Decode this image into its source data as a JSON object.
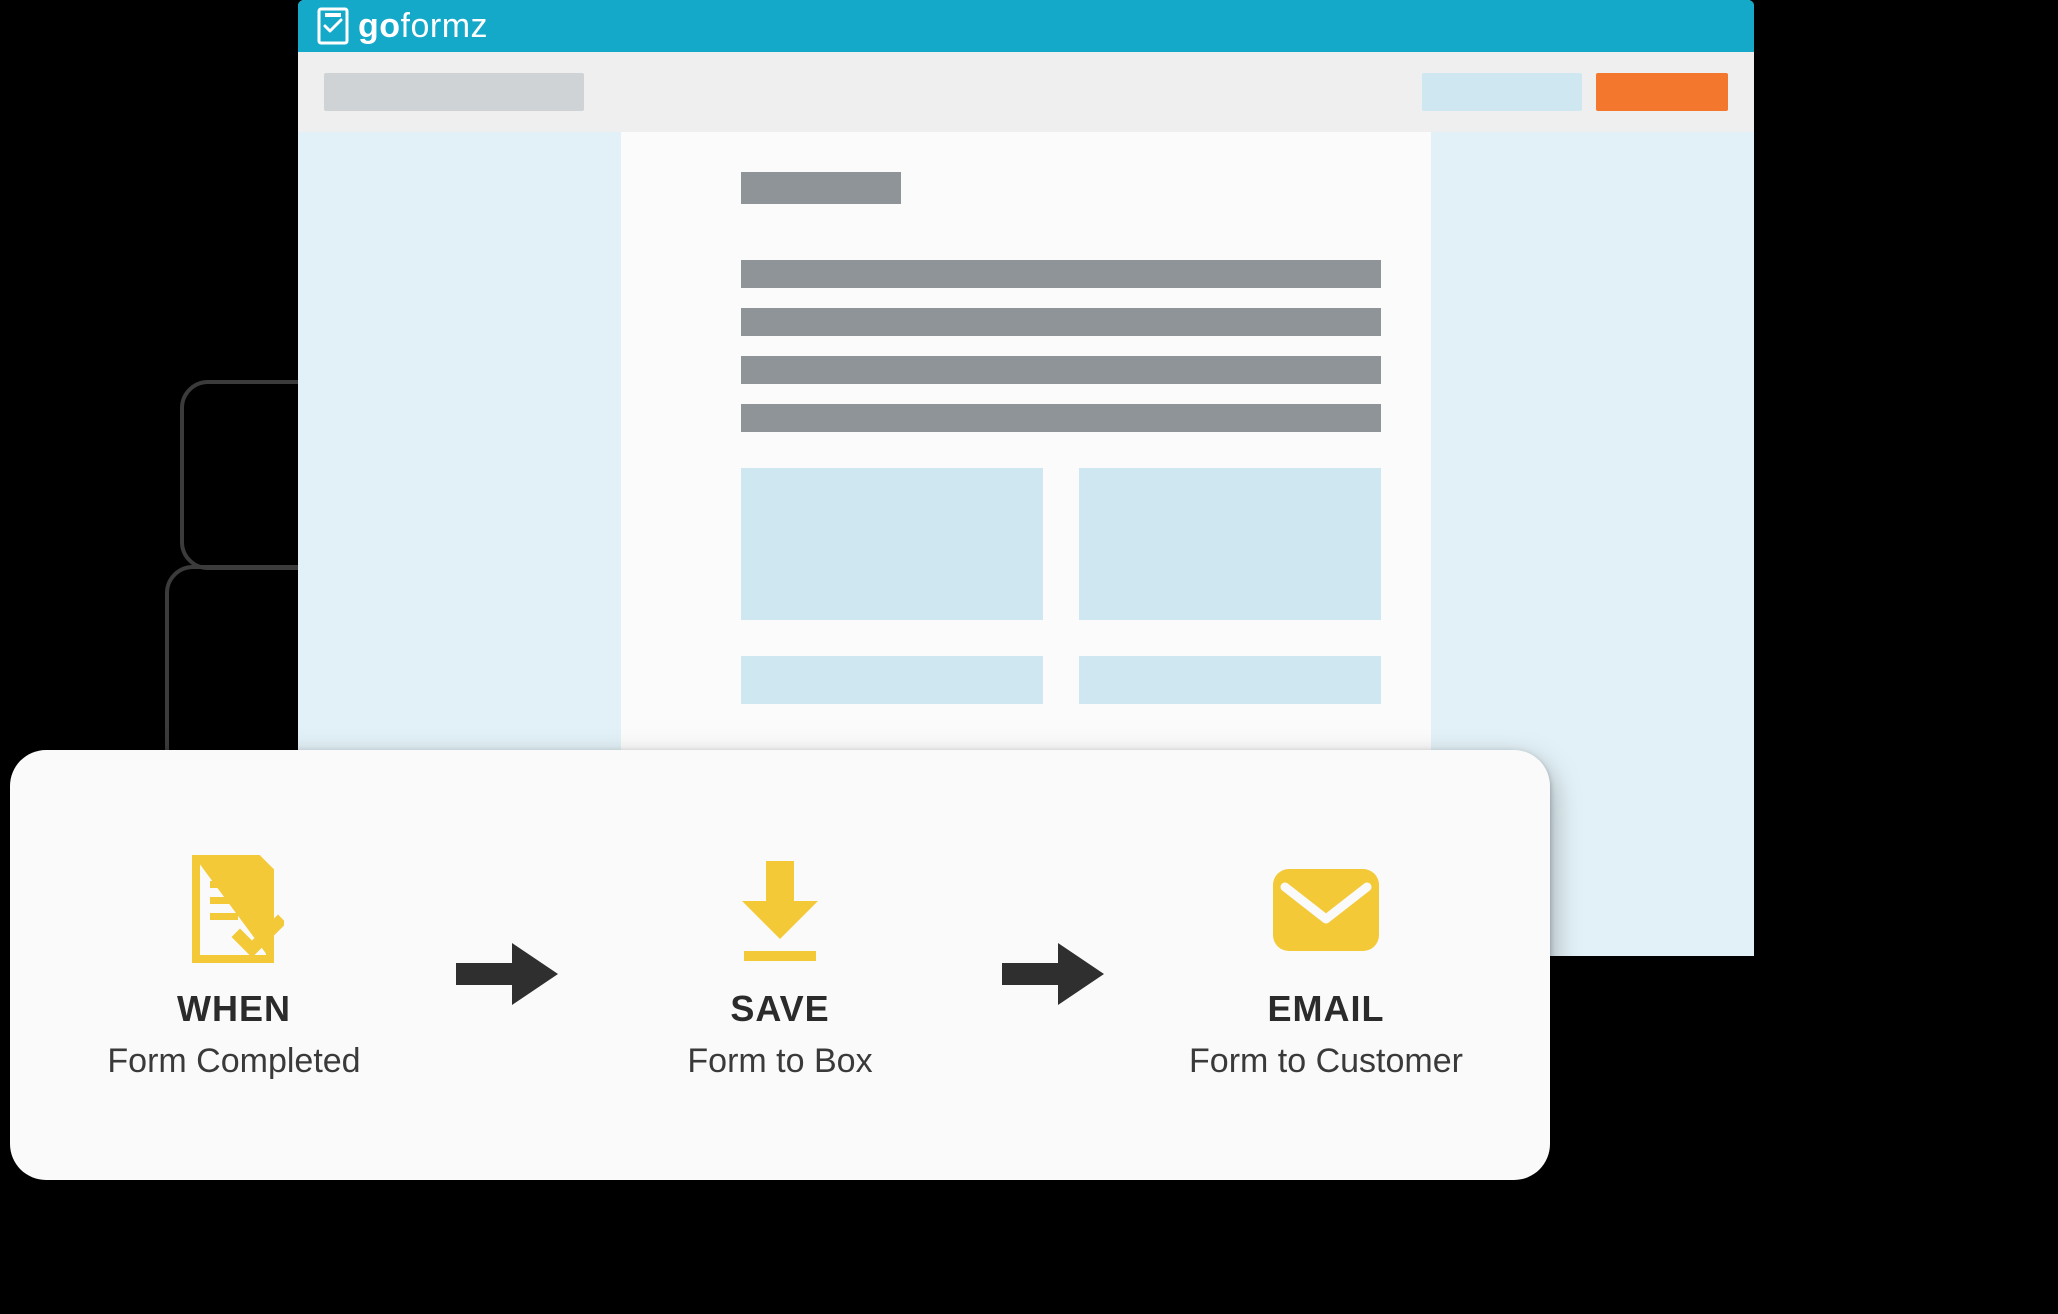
{
  "app": {
    "brand_prefix": "go",
    "brand_suffix": "formz"
  },
  "colors": {
    "brand_bar": "#14a8c9",
    "accent_yellow": "#f3c937",
    "cta_orange": "#f4772e",
    "placeholder_gray": "#8e9498",
    "panel_light": "#cfe7f0"
  },
  "workflow": {
    "steps": [
      {
        "icon": "form-check-icon",
        "title": "WHEN",
        "subtitle": "Form Completed"
      },
      {
        "icon": "download-icon",
        "title": "SAVE",
        "subtitle": "Form to Box"
      },
      {
        "icon": "mail-icon",
        "title": "EMAIL",
        "subtitle": "Form to Customer"
      }
    ]
  }
}
